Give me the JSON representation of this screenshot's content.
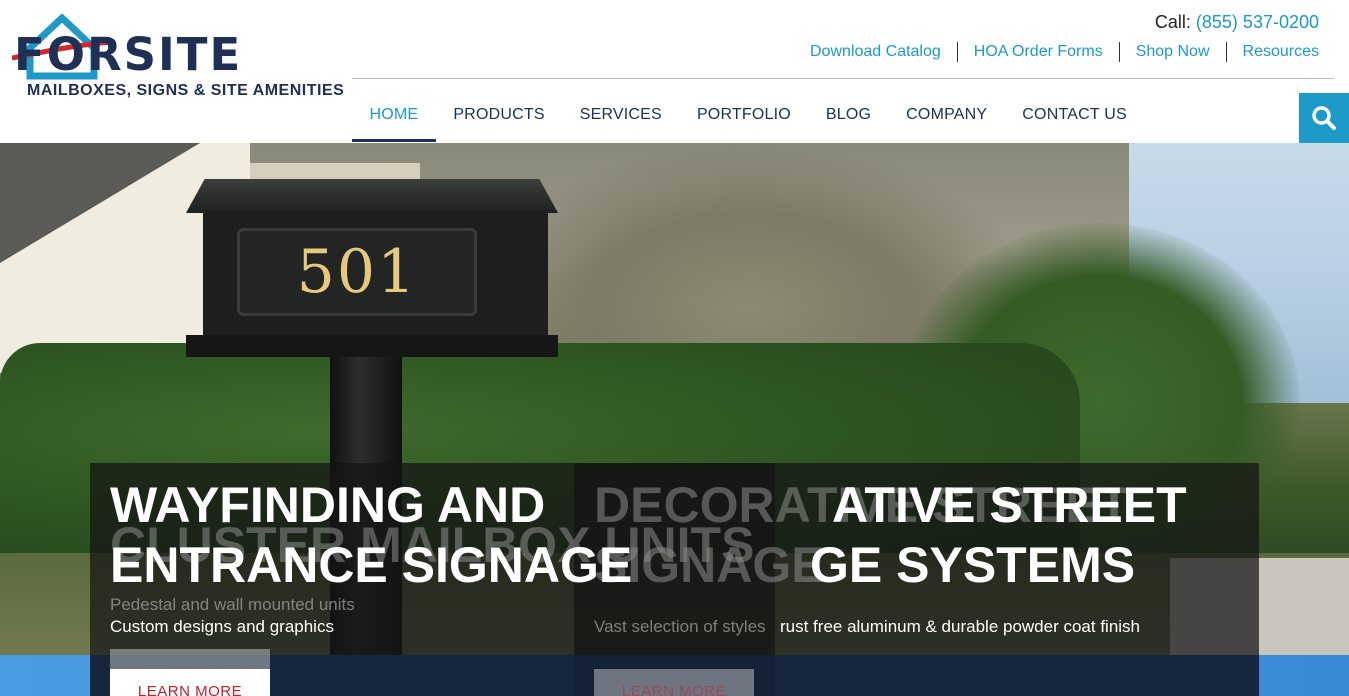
{
  "header": {
    "logo_word": "FORSITE",
    "logo_tagline": "MAILBOXES, SIGNS & SITE AMENITIES",
    "call_label": "Call:",
    "phone": "(855) 537-0200",
    "utility_links": [
      "Download Catalog",
      "HOA Order Forms",
      "Shop Now",
      "Resources"
    ],
    "nav": [
      "HOME",
      "PRODUCTS",
      "SERVICES",
      "PORTFOLIO",
      "BLOG",
      "COMPANY",
      "CONTACT US"
    ],
    "active_nav": "HOME",
    "search_icon": "search-icon"
  },
  "hero": {
    "mailbox_number": "501",
    "slide_left": {
      "ghost_title_line1": "CLUSTER MAILBOX UNITS",
      "title_line1": "WAYFINDING AND",
      "title_line2": "ENTRANCE SIGNAGE",
      "ghost_sub": "Pedestal and wall mounted units",
      "sub": "Custom designs and graphics",
      "button": "LEARN MORE"
    },
    "slide_right": {
      "ghost_title_line1": "DECORATIVE STREET",
      "ghost_title_line2": "SIGNAGE",
      "title_line1": "ATIVE STREET",
      "title_line2": "GE SYSTEMS",
      "ghost_sub": "Vast selection of styles",
      "sub": "rust free aluminum & durable powder coat finish",
      "button": "LEARN MORE"
    }
  },
  "colors": {
    "brand_blue": "#1d9ac7",
    "navy": "#1f2f55",
    "button_text": "#c0232b"
  }
}
